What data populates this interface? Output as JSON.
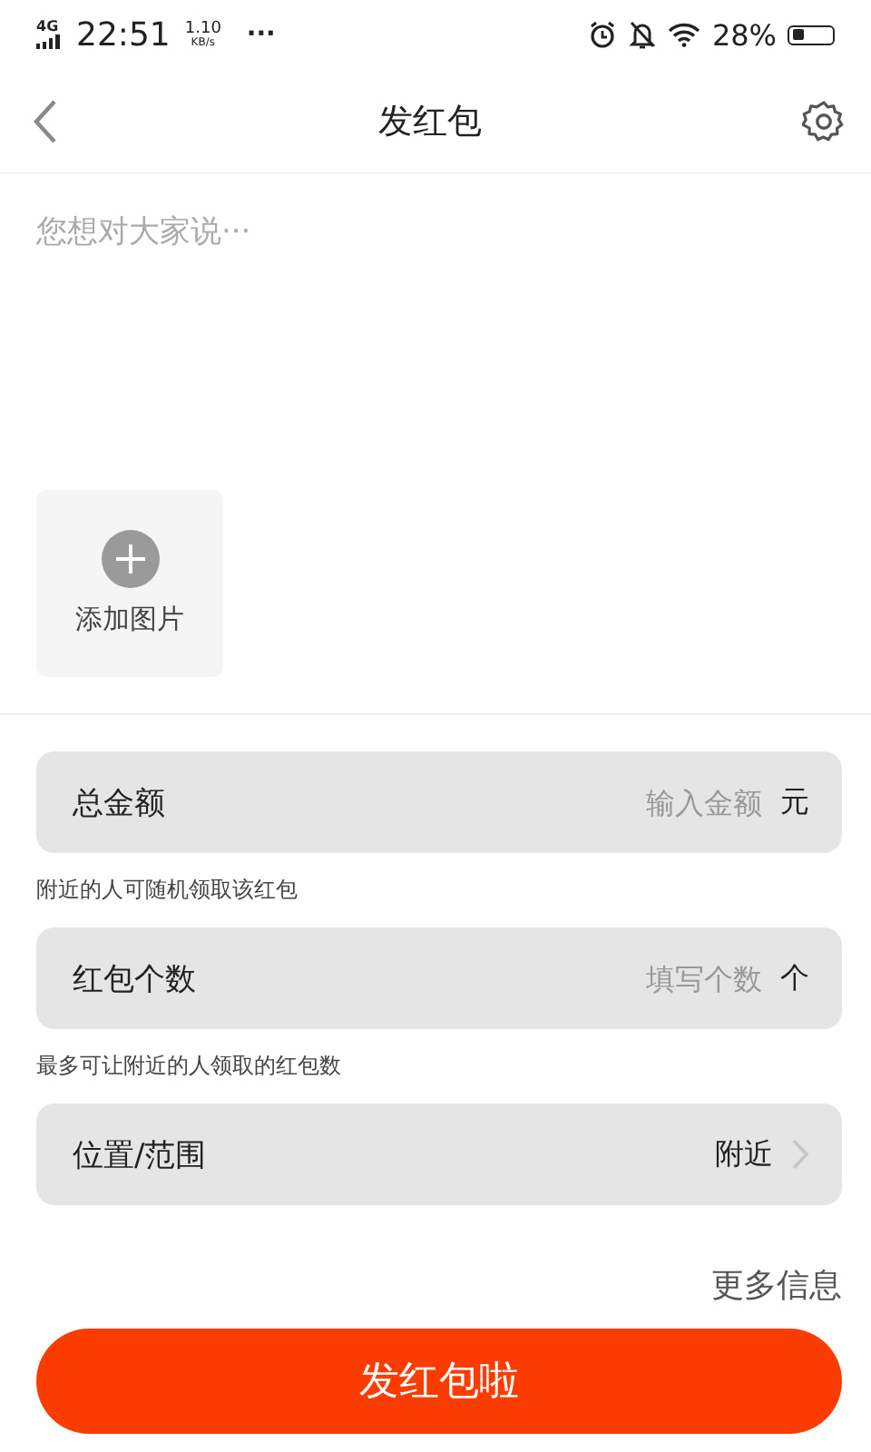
{
  "status_bar": {
    "network": "4G",
    "time": "22:51",
    "speed_value": "1.10",
    "speed_unit": "KB/s",
    "more": "···",
    "battery": "28%"
  },
  "header": {
    "title": "发红包"
  },
  "message": {
    "placeholder": "您想对大家说···"
  },
  "add_image": {
    "label": "添加图片"
  },
  "fields": [
    {
      "kind": "input",
      "label": "总金额",
      "placeholder": "输入金额",
      "unit": "元",
      "hint": "附近的人可随机领取该红包"
    },
    {
      "kind": "input",
      "label": "红包个数",
      "placeholder": "填写个数",
      "unit": "个",
      "hint": "最多可让附近的人领取的红包数"
    },
    {
      "kind": "select",
      "label": "位置/范围",
      "value": "附近"
    }
  ],
  "more_link": "更多信息",
  "submit_button": "发红包啦"
}
